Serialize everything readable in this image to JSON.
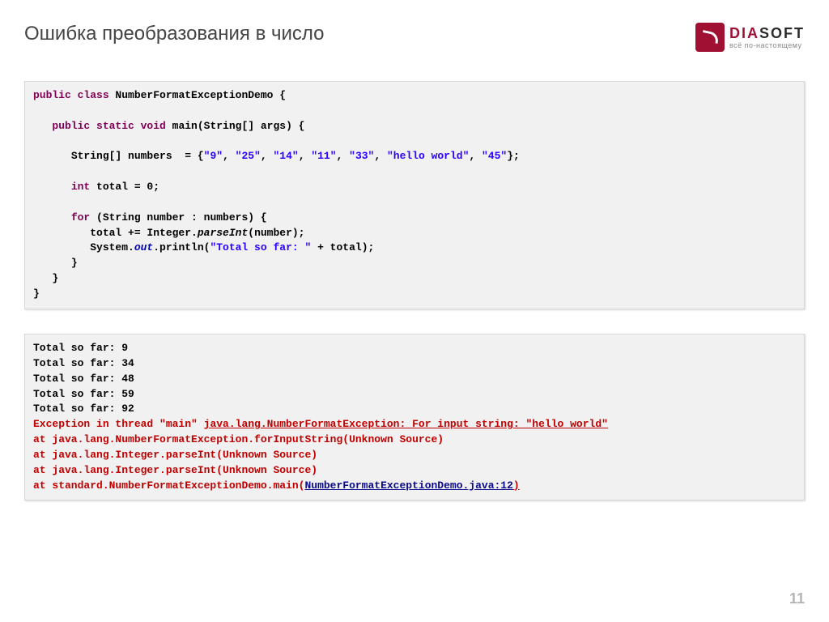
{
  "title": "Ошибка преобразования в число",
  "logo": {
    "name_pre": "DIA",
    "name_post": "SOFT",
    "tagline": "всё по-настоящему"
  },
  "code": {
    "l1a": "public class",
    "l1b": " NumberFormatExceptionDemo {",
    "l2a": "public static void",
    "l2b": " main(String[] args) {",
    "l3a": "String[] numbers  = {",
    "s1": "\"9\"",
    "s2": "\"25\"",
    "s3": "\"14\"",
    "s4": "\"11\"",
    "s5": "\"33\"",
    "s6": "\"hello world\"",
    "s7": "\"45\"",
    "l3b": "};",
    "l4a": "int",
    "l4b": " total = 0;",
    "l5a": "for",
    "l5b": " (String number : numbers) {",
    "l6a": "total += Integer.",
    "l6p": "parseInt",
    "l6b": "(number);",
    "l7a": "System.",
    "l7o": "out",
    "l7b": ".println(",
    "l7s": "\"Total so far: \"",
    "l7c": " + total);",
    "l8": "}",
    "l9": "}",
    "l10": "}",
    "comma": ", "
  },
  "output": {
    "o1": "Total so far: 9",
    "o2": "Total so far: 34",
    "o3": "Total so far: 48",
    "o4": "Total so far: 59",
    "o5": "Total so far: 92",
    "e1a": "Exception in thread \"main\" ",
    "e1b": "java.lang.NumberFormatException",
    "e1c": ": For input string: \"hello world\"",
    "e2": "at java.lang.NumberFormatException.forInputString(Unknown Source)",
    "e3": "at java.lang.Integer.parseInt(Unknown Source)",
    "e4": "at java.lang.Integer.parseInt(Unknown Source)",
    "e5a": "at standard.NumberFormatExceptionDemo.main(",
    "e5b": "NumberFormatExceptionDemo.java:12",
    "e5c": ")"
  },
  "page": "11"
}
